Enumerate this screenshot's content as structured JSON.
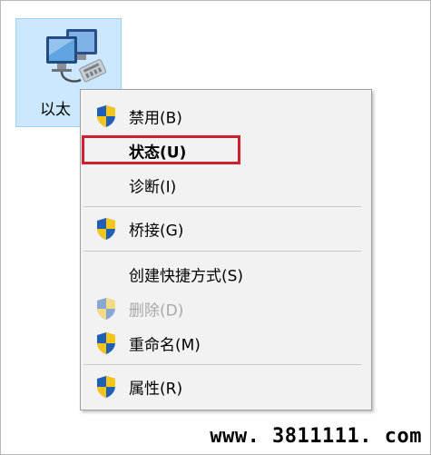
{
  "adapter": {
    "label": "以太",
    "icon": "ethernet-adapter-icon"
  },
  "context_menu": {
    "items": [
      {
        "label": "禁用(B)",
        "icon": "uac-shield-icon",
        "bold": false,
        "disabled": false,
        "highlighted": false
      },
      {
        "label": "状态(U)",
        "icon": "",
        "bold": true,
        "disabled": false,
        "highlighted": true
      },
      {
        "label": "诊断(I)",
        "icon": "",
        "bold": false,
        "disabled": false,
        "highlighted": false
      },
      {
        "label": "桥接(G)",
        "icon": "uac-shield-icon",
        "bold": false,
        "disabled": false,
        "highlighted": false
      },
      {
        "label": "创建快捷方式(S)",
        "icon": "",
        "bold": false,
        "disabled": false,
        "highlighted": false
      },
      {
        "label": "删除(D)",
        "icon": "uac-shield-icon",
        "bold": false,
        "disabled": true,
        "highlighted": false
      },
      {
        "label": "重命名(M)",
        "icon": "uac-shield-icon",
        "bold": false,
        "disabled": false,
        "highlighted": false
      },
      {
        "label": "属性(R)",
        "icon": "uac-shield-icon",
        "bold": false,
        "disabled": false,
        "highlighted": false
      }
    ]
  },
  "colors": {
    "selection_fill": "#cce8ff",
    "menu_background": "#f2f2f2",
    "highlight_box": "#d02030"
  },
  "watermark": "www. 3811111. com"
}
